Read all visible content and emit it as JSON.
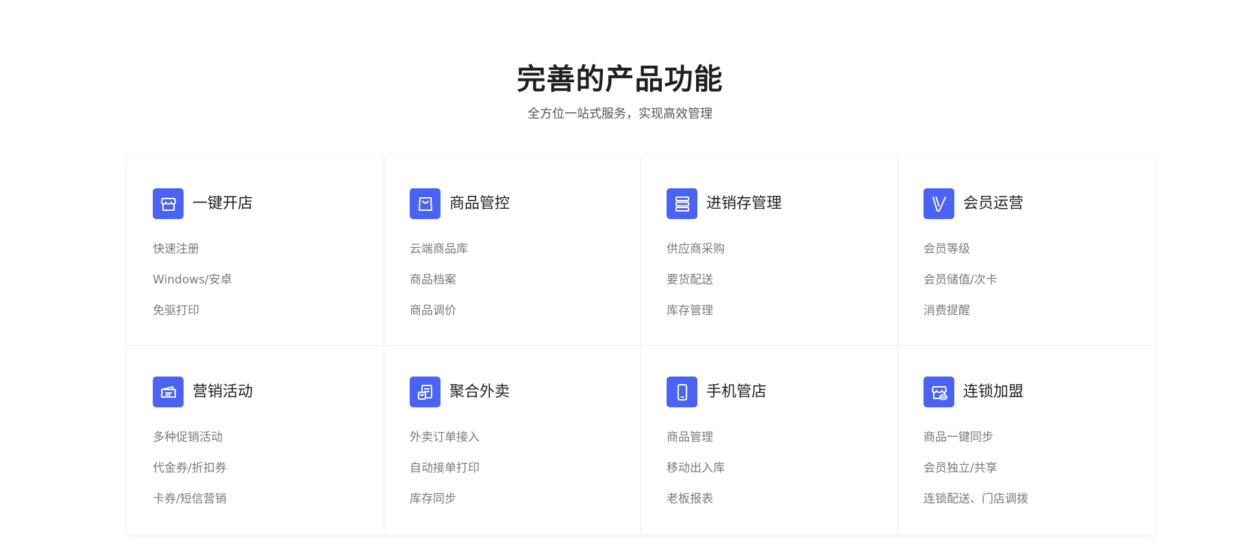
{
  "section": {
    "title": "完善的产品功能",
    "subtitle": "全方位一站式服务，实现高效管理"
  },
  "colors": {
    "accent": "#4a63f5",
    "title": "#1f1f1f",
    "feature_text": "#7a7a7a"
  },
  "cards": [
    {
      "icon": "store-icon",
      "title": "一键开店",
      "features": [
        "快速注册",
        "Windows/安卓",
        "免驱打印"
      ]
    },
    {
      "icon": "shopping-bag-icon",
      "title": "商品管控",
      "features": [
        "云端商品库",
        "商品档案",
        "商品调价"
      ]
    },
    {
      "icon": "inventory-stack-icon",
      "title": "进销存管理",
      "features": [
        "供应商采购",
        "要货配送",
        "库存管理"
      ]
    },
    {
      "icon": "vip-icon",
      "title": "会员运营",
      "features": [
        "会员等级",
        "会员储值/次卡",
        "消费提醒"
      ]
    },
    {
      "icon": "coupon-ticket-icon",
      "title": "营销活动",
      "features": [
        "多种促销活动",
        "代金券/折扣券",
        "卡券/短信营销"
      ]
    },
    {
      "icon": "takeout-order-icon",
      "title": "聚合外卖",
      "features": [
        "外卖订单接入",
        "自动接单打印",
        "库存同步"
      ]
    },
    {
      "icon": "mobile-phone-icon",
      "title": "手机管店",
      "features": [
        "商品管理",
        "移动出入库",
        "老板报表"
      ]
    },
    {
      "icon": "chain-store-icon",
      "title": "连锁加盟",
      "features": [
        "商品一键同步",
        "会员独立/共享",
        "连锁配送、门店调拨"
      ]
    }
  ]
}
